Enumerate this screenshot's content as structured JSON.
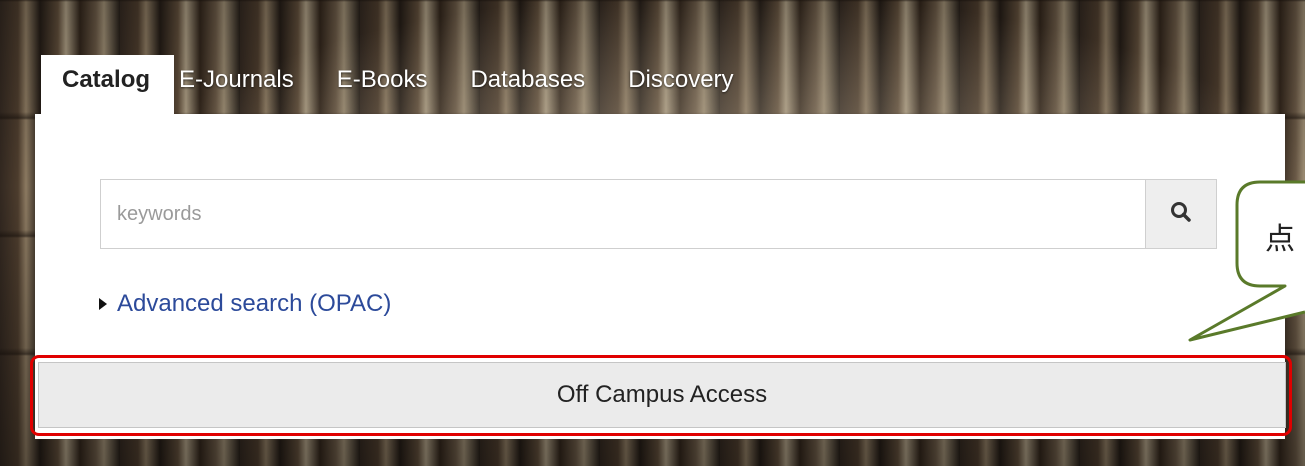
{
  "tabs": [
    {
      "label": "Catalog",
      "active": true
    },
    {
      "label": "E-Journals",
      "active": false
    },
    {
      "label": "E-Books",
      "active": false
    },
    {
      "label": "Databases",
      "active": false
    },
    {
      "label": "Discovery",
      "active": false
    }
  ],
  "search": {
    "placeholder": "keywords",
    "value": "",
    "button_icon": "search-icon"
  },
  "advanced": {
    "label": "Advanced search (OPAC)"
  },
  "off_campus": {
    "label": "Off Campus Access",
    "highlight_color": "#e00000"
  },
  "callout": {
    "text": "点",
    "border_color": "#5a7a2a"
  },
  "colors": {
    "link": "#2c4a9a",
    "panel": "#ffffff"
  }
}
